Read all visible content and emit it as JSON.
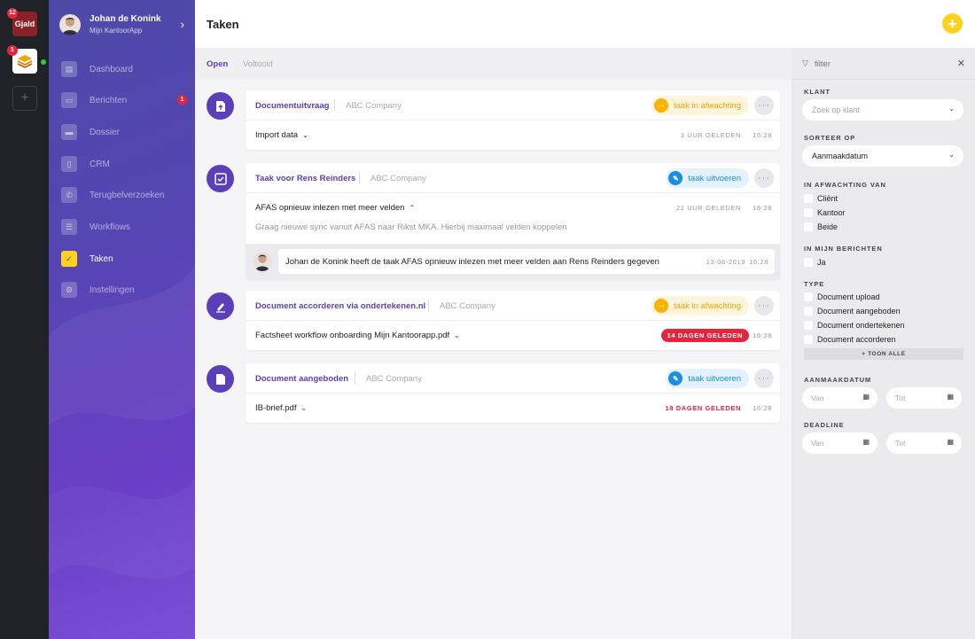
{
  "rail": {
    "apps": [
      {
        "label": "Gjald",
        "badge": "12"
      },
      {
        "label": "",
        "badge": "1"
      }
    ],
    "add_label": "+"
  },
  "user": {
    "name": "Johan de Konink",
    "subtitle": "Mijn KantoorApp"
  },
  "nav": [
    {
      "label": "Dashboard",
      "icon": "dashboard-icon"
    },
    {
      "label": "Berichten",
      "icon": "messages-icon",
      "badge": "1"
    },
    {
      "label": "Dossier",
      "icon": "folder-icon"
    },
    {
      "label": "CRM",
      "icon": "contacts-icon"
    },
    {
      "label": "Terugbelverzoeken",
      "icon": "phone-icon"
    },
    {
      "label": "Workflows",
      "icon": "list-icon"
    },
    {
      "label": "Taken",
      "icon": "check-icon",
      "active": true
    },
    {
      "label": "Instellingen",
      "icon": "gear-icon"
    }
  ],
  "header": {
    "title": "Taken",
    "add_label": "+"
  },
  "tabs": [
    {
      "label": "Open",
      "active": true
    },
    {
      "label": "Voltooid"
    }
  ],
  "tasks": [
    {
      "title": "Documentuitvraag",
      "company": "ABC Company",
      "status": "taak in afwachting",
      "status_type": "wait",
      "row": {
        "label": "Import data",
        "ago": "3 UUR GELEDEN",
        "time": "16:28"
      }
    },
    {
      "title": "Taak voor Rens Reinders",
      "company": "ABC Company",
      "status": "taak uitvoeren",
      "status_type": "exec",
      "row": {
        "label": "AFAS opnieuw inlezen met meer velden",
        "ago": "21 UUR GELEDEN",
        "time": "16:28"
      },
      "description": "Graag nieuwe sync vanuit AFAS naar Rikst MKA. Hierbij maximaal velden koppelen",
      "message": {
        "text": "Johan de Konink heeft de taak AFAS opnieuw inlezen met meer velden aan Rens Reinders gegeven",
        "date": "13-06-2019",
        "time": "16:28"
      }
    },
    {
      "title": "Document accorderen via ondertekenen.nl",
      "company": "ABC Company",
      "status": "taak in afwachting",
      "status_type": "wait",
      "row": {
        "label": "Factsheet workflow onboarding Mijn Kantoorapp.pdf",
        "ago": "14 DAGEN GELEDEN",
        "time": "16:28"
      }
    },
    {
      "title": "Document aangeboden",
      "company": "ABC Company",
      "status": "taak uitvoeren",
      "status_type": "exec",
      "row": {
        "label": "IB-brief.pdf",
        "ago": "18 DAGEN GELEDEN",
        "time": "16:28"
      }
    }
  ],
  "filter": {
    "title": "filter",
    "klant_label": "KLANT",
    "klant_placeholder": "Zoek op klant",
    "sort_label": "SORTEER OP",
    "sort_value": "Aanmaakdatum",
    "waiting_label": "IN AFWACHTING VAN",
    "waiting_options": [
      "Cliënt",
      "Kantoor",
      "Beide"
    ],
    "messages_label": "IN MIJN BERICHTEN",
    "messages_options": [
      "Ja"
    ],
    "type_label": "TYPE",
    "type_options": [
      "Document upload",
      "Document aangeboden",
      "Document ondertekenen",
      "Document accorderen"
    ],
    "show_all": "+ TOON ALLE",
    "created_label": "AANMAAKDATUM",
    "deadline_label": "DEADLINE",
    "from_placeholder": "Van",
    "to_placeholder": "Tot"
  },
  "colors": {
    "accent": "#5b3fb8",
    "yellow": "#ffd21f",
    "red": "#e3263c",
    "blue": "#1a8fe0",
    "orange": "#fbb200"
  }
}
